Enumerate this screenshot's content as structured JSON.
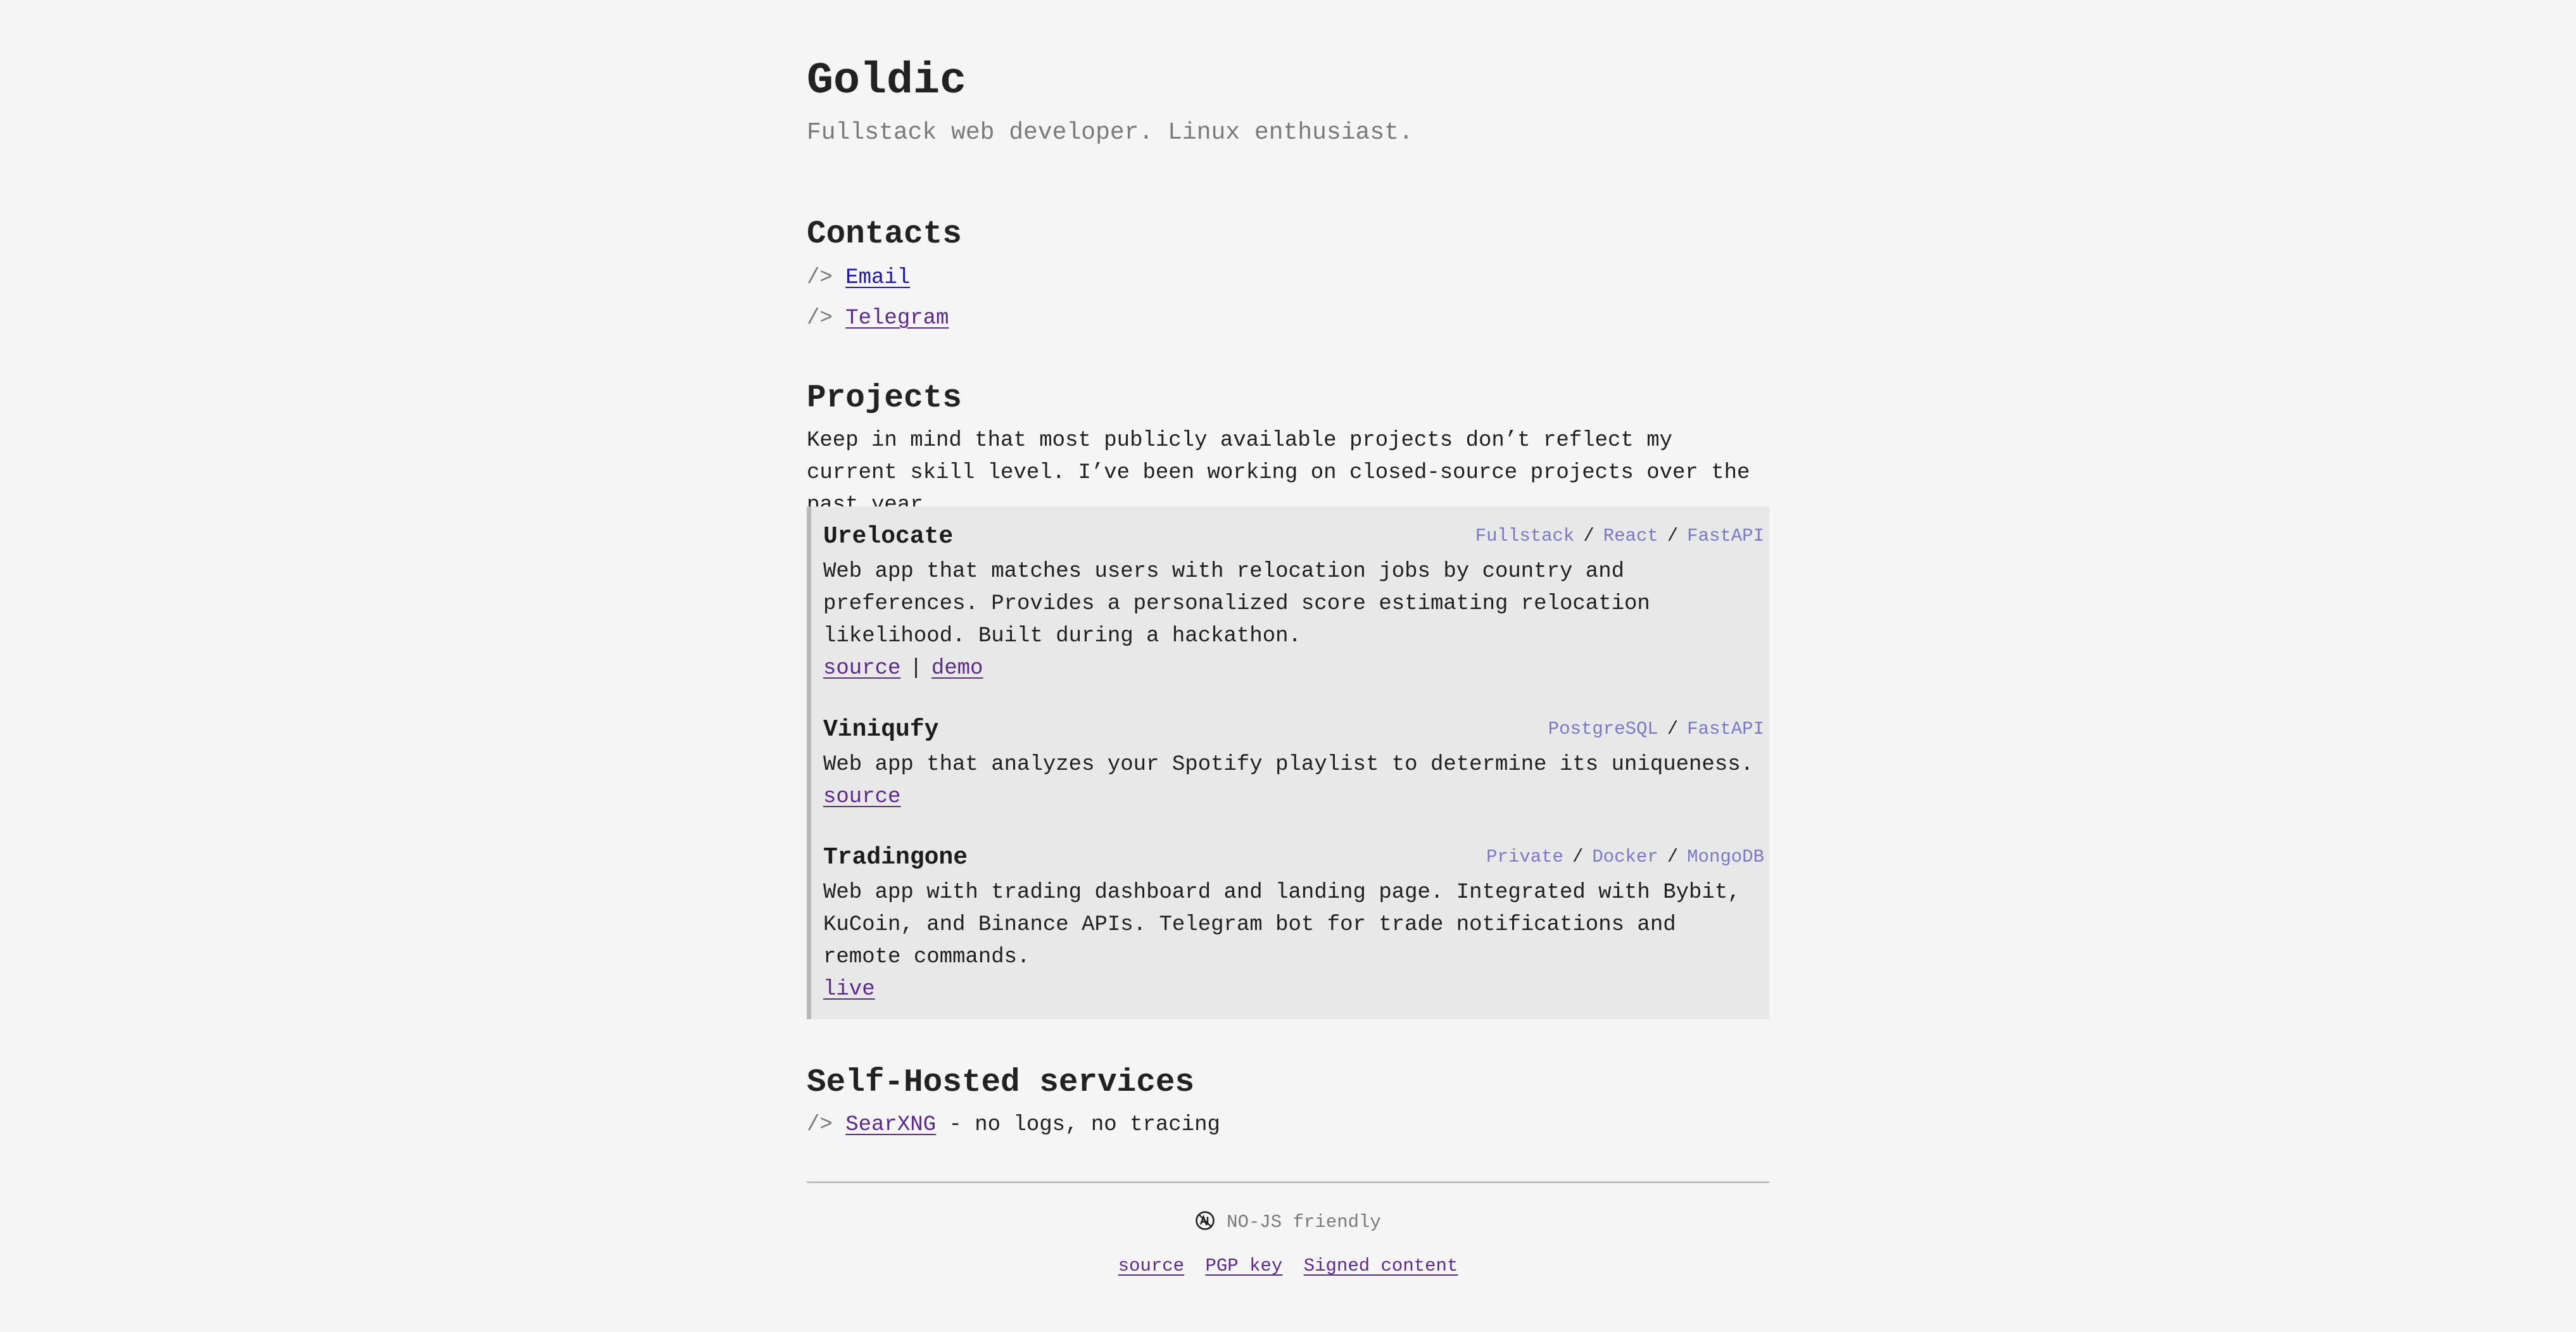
{
  "header": {
    "title": "Goldic",
    "subtitle": "Fullstack web developer. Linux enthusiast."
  },
  "contacts": {
    "heading": "Contacts",
    "prefix": "/>",
    "items": [
      {
        "label": "Email"
      },
      {
        "label": "Telegram"
      }
    ]
  },
  "projects": {
    "heading": "Projects",
    "intro": "Keep in mind that most publicly available projects don’t reflect my current skill level. I’ve been working on closed-source projects over the past year.",
    "tag_separator": "/",
    "link_separator": "|",
    "items": [
      {
        "name": "Urelocate",
        "tags": [
          "Fullstack",
          "React",
          "FastAPI"
        ],
        "description": "Web app that matches users with relocation jobs by country and preferences. Provides a personalized score estimating relocation likelihood. Built during a hackathon.",
        "links": [
          "source",
          "demo"
        ]
      },
      {
        "name": "Viniqufy",
        "tags": [
          "PostgreSQL",
          "FastAPI"
        ],
        "description": "Web app that analyzes your Spotify playlist to determine its uniqueness.",
        "links": [
          "source"
        ]
      },
      {
        "name": "Tradingone",
        "tags": [
          "Private",
          "Docker",
          "MongoDB"
        ],
        "description": "Web app with trading dashboard and landing page. Integrated with Bybit, KuCoin, and Binance APIs. Telegram bot for trade notifications and remote commands.",
        "links": [
          "live"
        ]
      }
    ]
  },
  "services": {
    "heading": "Self-Hosted services",
    "prefix": "/>",
    "items": [
      {
        "label": "SearXNG",
        "note": " - no logs, no tracing"
      }
    ]
  },
  "footer": {
    "note": "NO-JS friendly",
    "icon": "no-js-icon",
    "links": [
      "source",
      "PGP key",
      "Signed content"
    ]
  },
  "colors": {
    "background": "#f5f5f5",
    "project_box": "#e8e8e8",
    "link": "#5b2a86",
    "tag": "#7c78c2"
  }
}
